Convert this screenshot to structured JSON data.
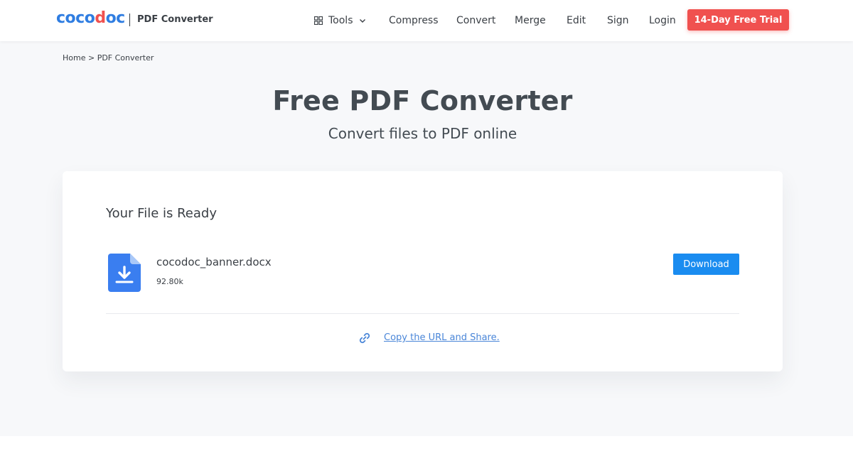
{
  "header": {
    "logo": {
      "part1": "coco",
      "part2": "d",
      "part3": "oc"
    },
    "product": "PDF Converter",
    "nav": {
      "tools": "Tools",
      "compress": "Compress",
      "convert": "Convert",
      "merge": "Merge",
      "edit": "Edit",
      "sign": "Sign",
      "login": "Login"
    },
    "trial_button": "14-Day Free Trial"
  },
  "breadcrumb": "Home > PDF Converter",
  "page": {
    "title": "Free PDF Converter",
    "subtitle": "Convert files to PDF online"
  },
  "card": {
    "heading": "Your File is Ready",
    "file": {
      "name": "cocodoc_banner.docx",
      "size": "92.80k",
      "icon": "file-download-icon"
    },
    "download_button": "Download",
    "share_link": "Copy the URL and Share.",
    "share_icon": "link-icon"
  },
  "colors": {
    "brand_blue": "#2f7de1",
    "brand_red": "#f0514f",
    "download_blue": "#1a8cf0",
    "link_blue": "#4a86d8",
    "page_bg": "#f7f8fa",
    "file_icon_blue": "#3a7ef0"
  }
}
